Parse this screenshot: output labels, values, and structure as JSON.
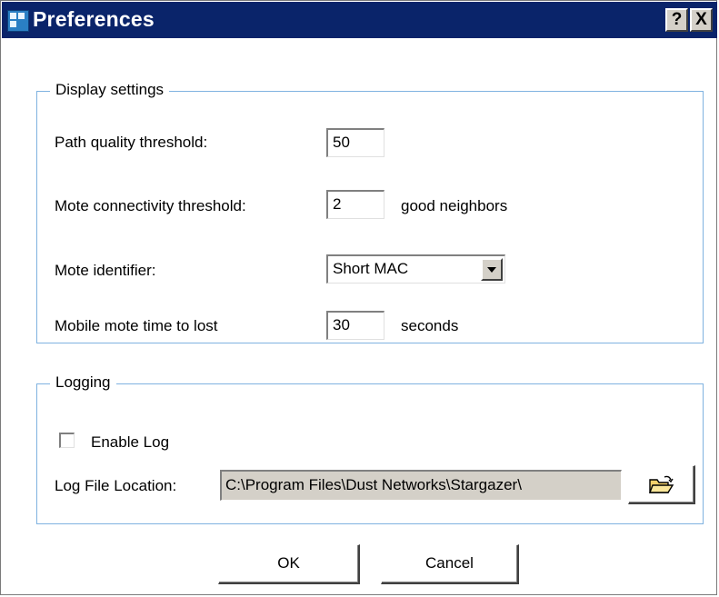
{
  "window": {
    "title": "Preferences",
    "help_label": "?",
    "close_label": "X"
  },
  "display": {
    "group_title": "Display settings",
    "path_quality": {
      "label": "Path quality threshold:",
      "value": "50"
    },
    "connectivity": {
      "label": "Mote connectivity threshold:",
      "value": "2",
      "suffix": "good neighbors"
    },
    "identifier": {
      "label": "Mote identifier:",
      "selected": "Short MAC"
    },
    "mobile_lost": {
      "label": "Mobile mote time to lost",
      "value": "30",
      "suffix": "seconds"
    }
  },
  "logging": {
    "group_title": "Logging",
    "enable_log_label": "Enable Log",
    "enable_log_checked": false,
    "file_location_label": "Log File Location:",
    "file_location_value": "C:\\Program Files\\Dust Networks\\Stargazer\\",
    "browse_icon": "folder-open-icon"
  },
  "buttons": {
    "ok_label": "OK",
    "cancel_label": "Cancel"
  },
  "colors": {
    "titlebar": "#0a246a",
    "group_border": "#7fb2e0",
    "readonly_bg": "#d4d0c8"
  }
}
